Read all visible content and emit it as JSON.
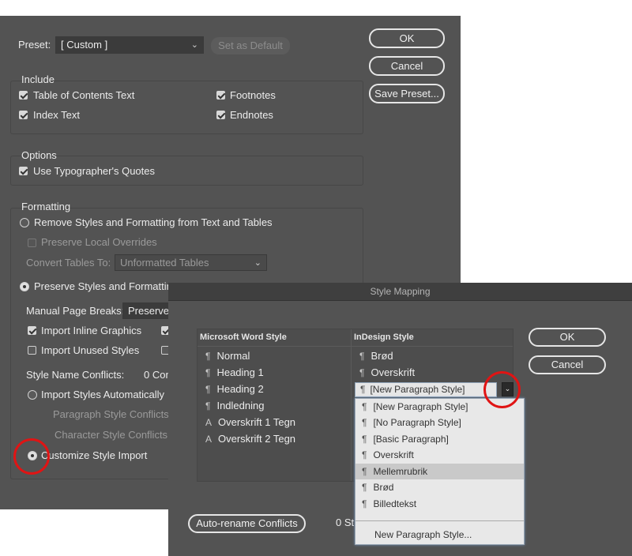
{
  "import_options": {
    "preset_label": "Preset:",
    "preset_value": "[ Custom ]",
    "set_default": "Set as Default",
    "ok": "OK",
    "cancel": "Cancel",
    "save_preset": "Save Preset...",
    "include": {
      "title": "Include",
      "toc": "Table of Contents Text",
      "index": "Index Text",
      "footnotes": "Footnotes",
      "endnotes": "Endnotes"
    },
    "options": {
      "title": "Options",
      "typographers_quotes": "Use Typographer's Quotes"
    },
    "formatting": {
      "title": "Formatting",
      "remove_styles": "Remove Styles and Formatting from Text and Tables",
      "preserve_local": "Preserve Local Overrides",
      "convert_tables_label": "Convert Tables To:",
      "convert_tables_value": "Unformatted Tables",
      "preserve_styles": "Preserve Styles and Formatting",
      "manual_breaks_label": "Manual Page Breaks:",
      "manual_breaks_value": "Preserve P",
      "inline_graphics": "Import Inline Graphics",
      "unused_styles": "Import Unused Styles",
      "name_conflicts_label": "Style Name Conflicts:",
      "name_conflicts_value": "0 Con",
      "import_auto": "Import Styles Automatically",
      "para_conflicts": "Paragraph Style Conflicts:",
      "char_conflicts": "Character Style Conflicts:",
      "customize": "Customize Style Import"
    }
  },
  "style_mapping": {
    "title": "Style Mapping",
    "col_word": "Microsoft Word Style",
    "col_indesign": "InDesign Style",
    "ok": "OK",
    "cancel": "Cancel",
    "auto_rename": "Auto-rename Conflicts",
    "conflicts_text": "0 St",
    "rows": [
      {
        "icon": "¶",
        "word": "Normal",
        "indesign": "Brød"
      },
      {
        "icon": "¶",
        "word": "Heading 1",
        "indesign": "Overskrift"
      },
      {
        "icon": "¶",
        "word": "Heading 2",
        "indesign": "[New Paragraph Style]"
      },
      {
        "icon": "¶",
        "word": "Indledning",
        "indesign": ""
      },
      {
        "icon": "A",
        "word": "Overskrift 1 Tegn",
        "indesign": ""
      },
      {
        "icon": "A",
        "word": "Overskrift 2 Tegn",
        "indesign": ""
      }
    ],
    "dropdown": {
      "items": [
        {
          "label": "[New Paragraph Style]",
          "highlighted": false
        },
        {
          "label": "[No Paragraph Style]",
          "highlighted": false
        },
        {
          "label": "[Basic Paragraph]",
          "highlighted": false
        },
        {
          "label": "Overskrift",
          "highlighted": false
        },
        {
          "label": "Mellemrubrik",
          "highlighted": true
        },
        {
          "label": "Brød",
          "highlighted": false
        },
        {
          "label": "Billedtekst",
          "highlighted": false
        }
      ],
      "new_style": "New Paragraph Style..."
    }
  },
  "colors": {
    "dialog_bg": "#535353",
    "annotation_red": "#e01414"
  }
}
